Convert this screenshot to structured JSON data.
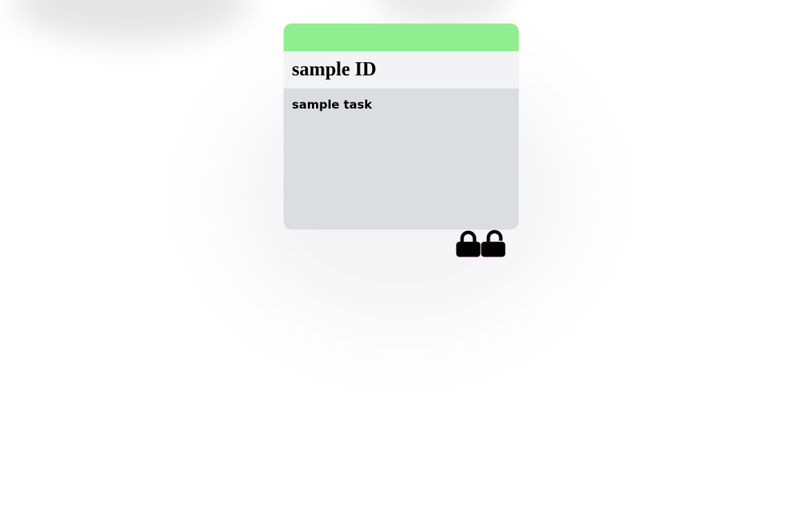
{
  "card": {
    "header_color": "#90ee90",
    "id": "sample ID",
    "task": "sample task"
  },
  "controls": {
    "lock_icon": "lock-closed-icon",
    "unlock_icon": "lock-open-icon"
  }
}
